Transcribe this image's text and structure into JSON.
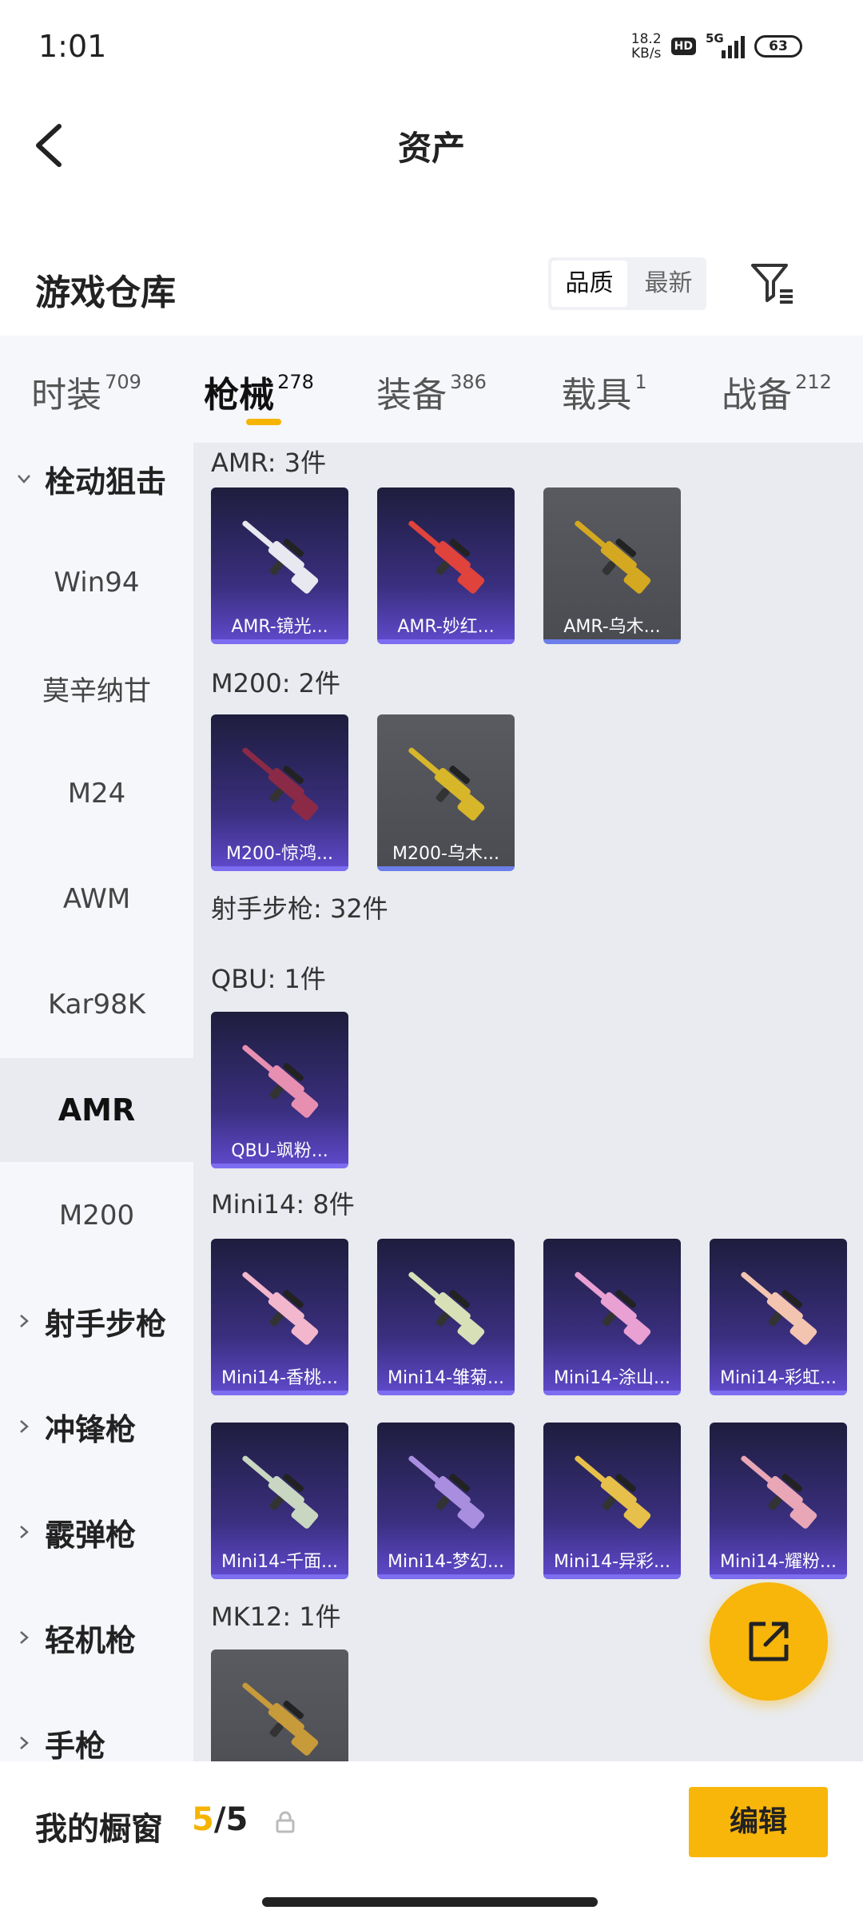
{
  "status": {
    "time": "1:01",
    "speed_value": "18.2",
    "speed_unit": "KB/s",
    "hd": "HD",
    "network": "5G",
    "battery": "63"
  },
  "header": {
    "title": "资产"
  },
  "section": {
    "title": "游戏仓库",
    "sort_quality": "品质",
    "sort_newest": "最新"
  },
  "tabs": [
    {
      "label": "时装",
      "count": "709"
    },
    {
      "label": "枪械",
      "count": "278"
    },
    {
      "label": "装备",
      "count": "386"
    },
    {
      "label": "载具",
      "count": "1"
    },
    {
      "label": "战备",
      "count": "212"
    }
  ],
  "sidebar": [
    {
      "label": "栓动狙击"
    },
    {
      "label": "Win94"
    },
    {
      "label": "莫辛纳甘"
    },
    {
      "label": "M24"
    },
    {
      "label": "AWM"
    },
    {
      "label": "Kar98K"
    },
    {
      "label": "AMR"
    },
    {
      "label": "M200"
    },
    {
      "label": "射手步枪"
    },
    {
      "label": "冲锋枪"
    },
    {
      "label": "霰弹枪"
    },
    {
      "label": "轻机枪"
    },
    {
      "label": "手枪"
    }
  ],
  "groups": [
    {
      "label": "AMR: 3件"
    },
    {
      "label": "M200: 2件"
    },
    {
      "label": "射手步枪: 32件"
    },
    {
      "label": "QBU: 1件"
    },
    {
      "label": "Mini14: 8件"
    },
    {
      "label": "MK12: 1件"
    }
  ],
  "items": [
    {
      "name": "AMR-镜光...",
      "color": "#e8e8f0"
    },
    {
      "name": "AMR-妙红...",
      "color": "#e0433c"
    },
    {
      "name": "AMR-乌木...",
      "color": "#d4a820"
    },
    {
      "name": "M200-惊鸿...",
      "color": "#8a2a46"
    },
    {
      "name": "M200-乌木...",
      "color": "#d7b62a"
    },
    {
      "name": "QBU-飒粉...",
      "color": "#e78fb0"
    },
    {
      "name": "Mini14-香桃...",
      "color": "#f2b7cc"
    },
    {
      "name": "Mini14-雏菊...",
      "color": "#d8e0b8"
    },
    {
      "name": "Mini14-涂山...",
      "color": "#e9a0d2"
    },
    {
      "name": "Mini14-彩虹...",
      "color": "#f3c4b0"
    },
    {
      "name": "Mini14-千面...",
      "color": "#c9d7c2"
    },
    {
      "name": "Mini14-梦幻...",
      "color": "#a98ee0"
    },
    {
      "name": "Mini14-异彩...",
      "color": "#e6c04a"
    },
    {
      "name": "Mini14-耀粉...",
      "color": "#e8a6b6"
    },
    {
      "name": "",
      "color": "#c79a3a"
    }
  ],
  "bottom": {
    "showcase_label": "我的橱窗",
    "showcase_current": "5",
    "showcase_total": "/5",
    "edit": "编辑"
  },
  "colors": {
    "accent": "#f8b50a"
  }
}
